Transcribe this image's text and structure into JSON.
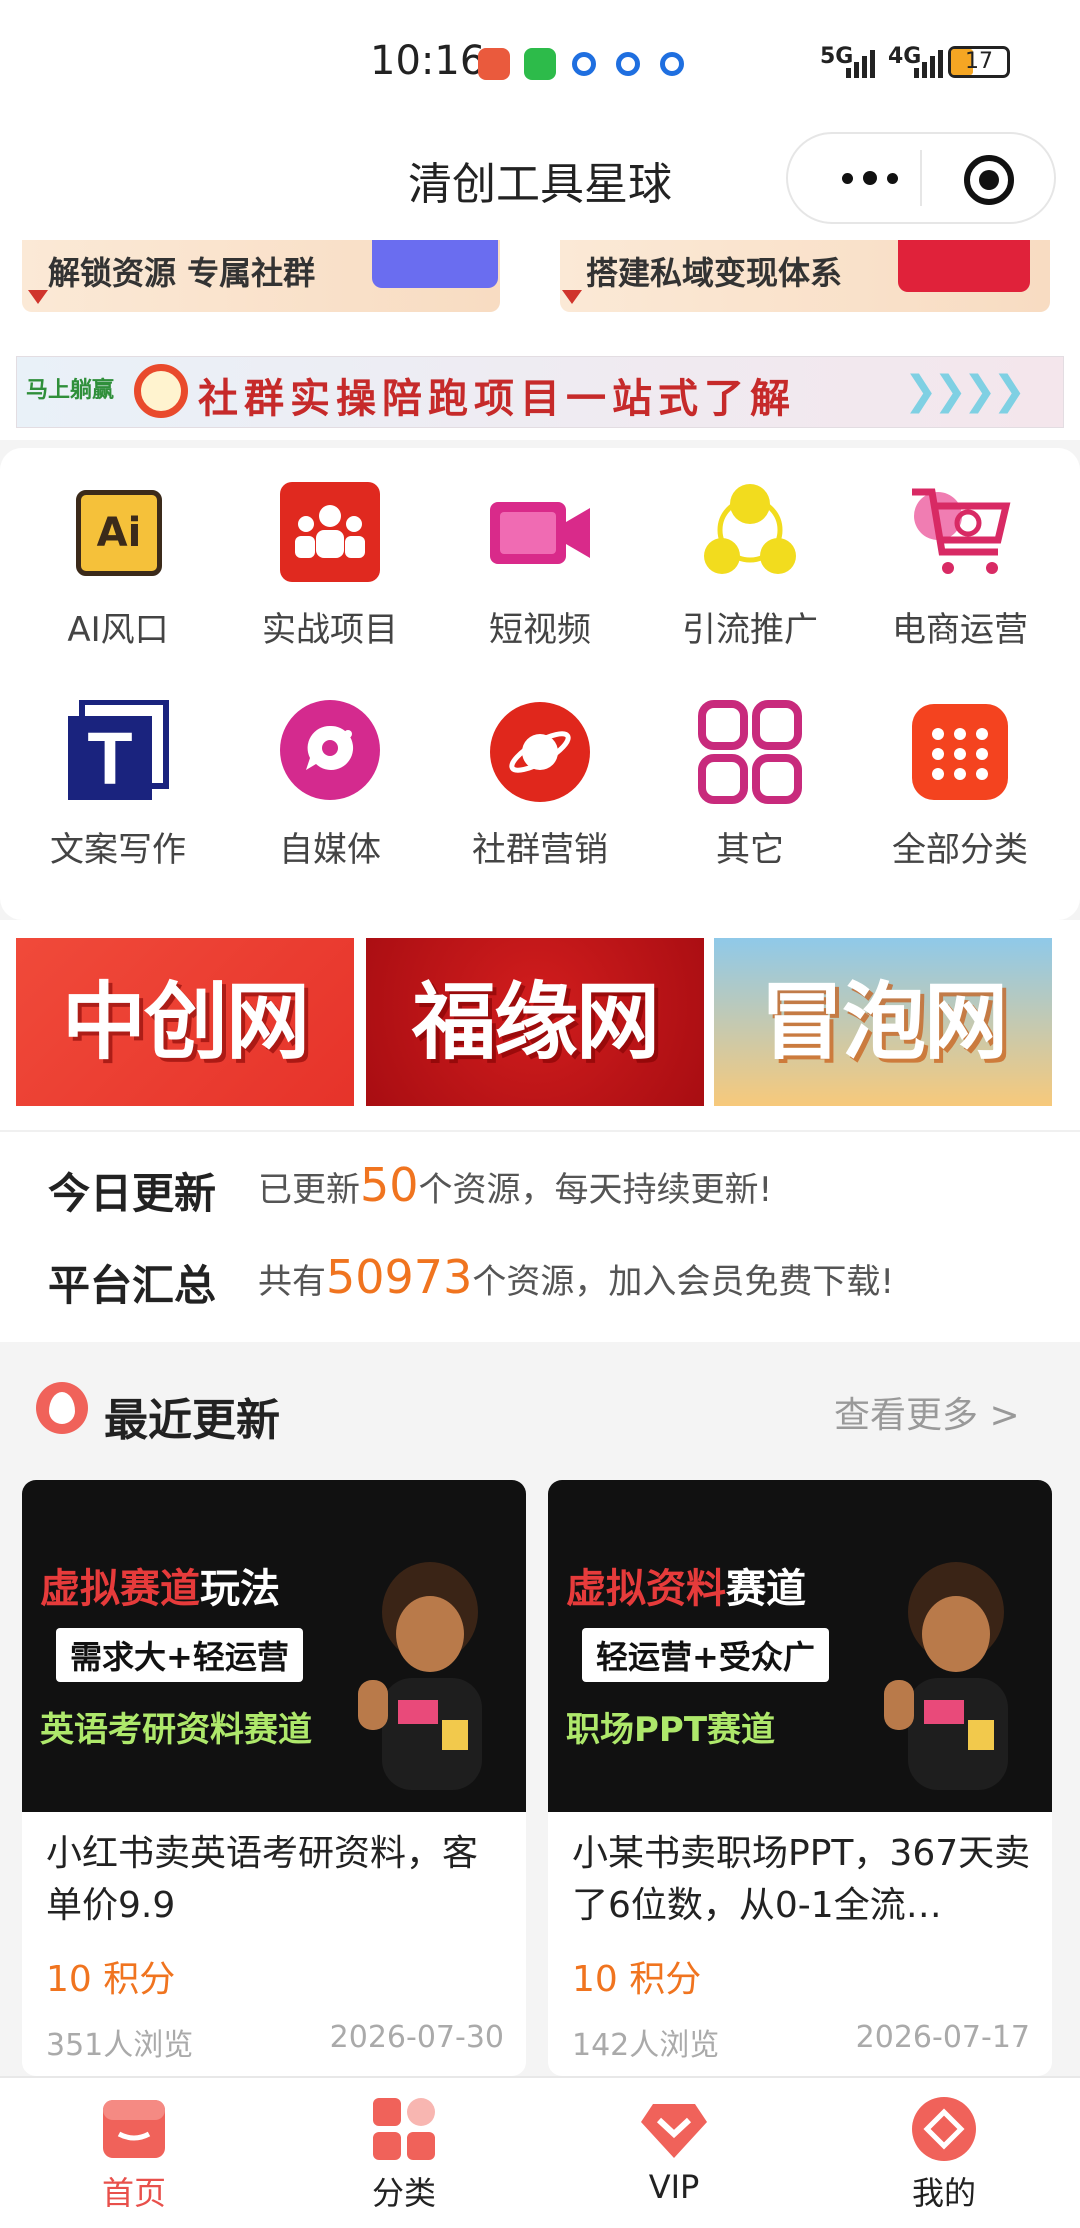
{
  "status_bar": {
    "time": "10:16",
    "network1": "5G",
    "network2": "4G",
    "battery": "17"
  },
  "navbar": {
    "title": "清创工具星球"
  },
  "top_banners": [
    {
      "label": "解锁资源 专属社群"
    },
    {
      "label": "搭建私域变现体系"
    }
  ],
  "ad_strip": {
    "logo": "马上躺赢",
    "text": "社群实操陪跑项目一站式了解"
  },
  "categories": [
    {
      "label": "AI风口",
      "icon": "ai-icon",
      "color": "#f5c13a"
    },
    {
      "label": "实战项目",
      "icon": "team-icon",
      "color": "#e0291f"
    },
    {
      "label": "短视频",
      "icon": "video-camera-icon",
      "color": "#d92a8a"
    },
    {
      "label": "引流推广",
      "icon": "share-nodes-icon",
      "color": "#f2dc1e"
    },
    {
      "label": "电商运营",
      "icon": "shopping-cart-icon",
      "color": "#d82a64"
    },
    {
      "label": "文案写作",
      "icon": "text-t-icon",
      "color": "#1a237e"
    },
    {
      "label": "自媒体",
      "icon": "media-chat-icon",
      "color": "#d42a8e"
    },
    {
      "label": "社群营销",
      "icon": "planet-icon",
      "color": "#e0271c"
    },
    {
      "label": "其它",
      "icon": "grid-four-icon",
      "color": "#c82a7c"
    },
    {
      "label": "全部分类",
      "icon": "dots-grid-icon",
      "color": "#f4431f"
    }
  ],
  "promos": [
    {
      "label": "中创网"
    },
    {
      "label": "福缘网"
    },
    {
      "label": "冒泡网"
    }
  ],
  "stats": {
    "today_title": "今日更新",
    "today_prefix": "已更新",
    "today_count": "50",
    "today_suffix": "个资源，每天持续更新!",
    "total_title": "平台汇总",
    "total_prefix": "共有",
    "total_count": "50973",
    "total_suffix": "个资源，加入会员免费下载!"
  },
  "recent": {
    "title": "最近更新",
    "more": "查看更多 >",
    "items": [
      {
        "thumb_red": "虚拟赛道",
        "thumb_white": "玩法",
        "thumb_tag": "需求大+轻运营",
        "thumb_green": "英语考研资料赛道",
        "title": "小红书卖英语考研资料，客单价9.9",
        "points": "10 积分",
        "views": "351人浏览",
        "date": "2026-07-30"
      },
      {
        "thumb_red": "虚拟资料",
        "thumb_white": "赛道",
        "thumb_tag": "轻运营+受众广",
        "thumb_green": "职场PPT赛道",
        "title": "小某书卖职场PPT，367天卖了6位数，从0-1全流…",
        "points": "10 积分",
        "views": "142人浏览",
        "date": "2026-07-17"
      }
    ]
  },
  "tabbar": [
    {
      "label": "首页",
      "icon": "store-icon",
      "active": true
    },
    {
      "label": "分类",
      "icon": "category-icon",
      "active": false
    },
    {
      "label": "VIP",
      "icon": "vip-diamond-icon",
      "active": false
    },
    {
      "label": "我的",
      "icon": "profile-icon",
      "active": false
    }
  ],
  "colors": {
    "accent": "#f0741f",
    "tab_active": "#e8504b"
  }
}
